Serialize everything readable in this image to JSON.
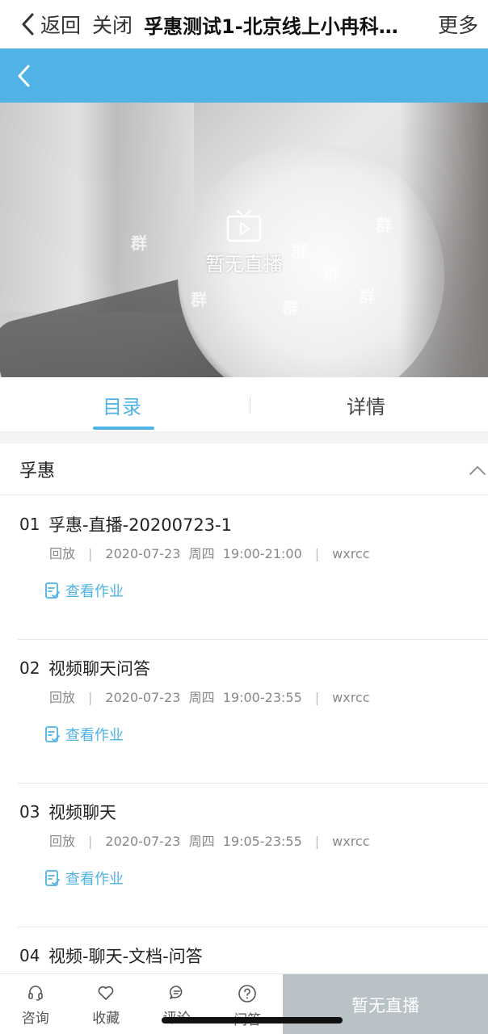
{
  "topnav": {
    "back_label": "返回",
    "close_label": "关闭",
    "title": "孚惠测试1-北京线上小冉科…",
    "more_label": "更多"
  },
  "player": {
    "status_text": "暂无直播",
    "watermark": "群"
  },
  "tabs": [
    {
      "label": "目录",
      "active": true
    },
    {
      "label": "详情",
      "active": false
    }
  ],
  "section": {
    "name": "孚惠"
  },
  "lessons": [
    {
      "no": "01",
      "name": "孚惠-直播-20200723-1",
      "type": "回放",
      "date": "2020-07-23",
      "weekday": "周四",
      "time": "19:00-21:00",
      "teacher": "wxrcc",
      "homework_label": "查看作业"
    },
    {
      "no": "02",
      "name": "视频聊天问答",
      "type": "回放",
      "date": "2020-07-23",
      "weekday": "周四",
      "time": "19:00-23:55",
      "teacher": "wxrcc",
      "homework_label": "查看作业"
    },
    {
      "no": "03",
      "name": "视频聊天",
      "type": "回放",
      "date": "2020-07-23",
      "weekday": "周四",
      "time": "19:05-23:55",
      "teacher": "wxrcc",
      "homework_label": "查看作业"
    },
    {
      "no": "04",
      "name": "视频-聊天-文档-问答"
    }
  ],
  "bottombar": {
    "items": [
      {
        "label": "咨询",
        "icon": "headset-icon"
      },
      {
        "label": "收藏",
        "icon": "heart-icon"
      },
      {
        "label": "评论",
        "icon": "comment-icon"
      },
      {
        "label": "问答",
        "icon": "question-icon"
      }
    ],
    "cta_label": "暂无直播"
  },
  "colors": {
    "accent": "#4fb3e6",
    "cta_disabled": "#b9c2c6"
  }
}
